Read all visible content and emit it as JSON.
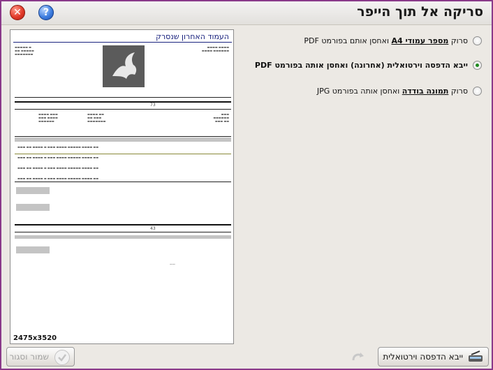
{
  "window": {
    "title": "סריקה אל תוך הייפר",
    "close_icon": "close-icon",
    "help_icon": "help-icon",
    "help_glyph": "?",
    "close_glyph": "✕"
  },
  "preview": {
    "doc_title": "העמוד האחרון שנסרק",
    "size_label": "2475x3520",
    "inner": {
      "shipment_no": "73",
      "shipment_no_2": "43"
    }
  },
  "options": [
    {
      "pre": "סרוק ",
      "em": "מספר עמודי A4",
      "post": " ואחסן אותם בפורמט PDF",
      "selected": false,
      "bold_all": false
    },
    {
      "pre": "",
      "em": "",
      "post": "ייבא הדפסה וירטואלית (אחרונה) ואחסן אותה בפורמט PDF",
      "selected": true,
      "bold_all": true
    },
    {
      "pre": "סרוק ",
      "em": "תמונה בודדה",
      "post": " ואחסן אותה בפורמט JPG",
      "selected": false,
      "bold_all": false
    }
  ],
  "buttons": {
    "import_label": "ייבא הדפסה וירטואלית",
    "save_close_label": "שמור וסגור"
  },
  "colors": {
    "window_border": "#8a3a8a",
    "background": "#ece9e4",
    "selected_radio": "#1f8a1f",
    "preview_title": "#1a237e"
  }
}
